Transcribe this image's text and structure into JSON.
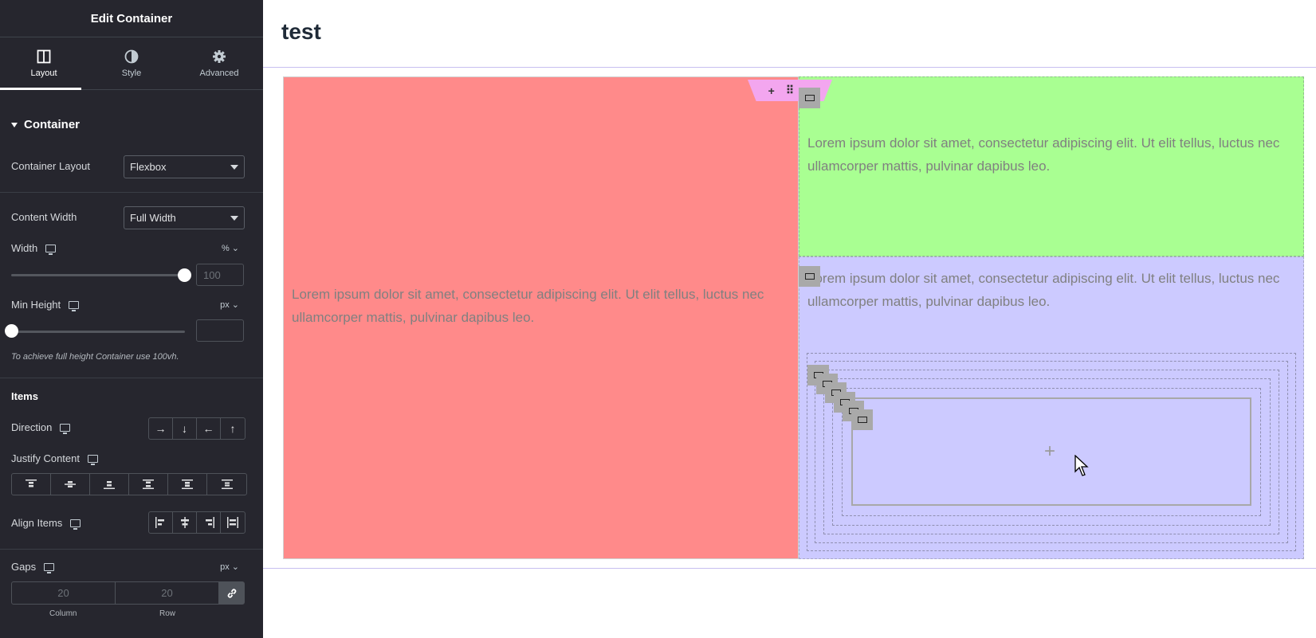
{
  "sidebar": {
    "title": "Edit Container",
    "tabs": [
      {
        "label": "Layout",
        "icon": "layout-icon",
        "active": true
      },
      {
        "label": "Style",
        "icon": "contrast-icon"
      },
      {
        "label": "Advanced",
        "icon": "gear-icon"
      }
    ],
    "section_title": "Container",
    "container_layout": {
      "label": "Container Layout",
      "value": "Flexbox"
    },
    "content_width": {
      "label": "Content Width",
      "value": "Full Width"
    },
    "width": {
      "label": "Width",
      "unit": "%",
      "value": "100",
      "slider_fraction": 1.0
    },
    "min_height": {
      "label": "Min Height",
      "unit": "px",
      "value": "",
      "slider_fraction": 0.0
    },
    "note": "To achieve full height Container use 100vh.",
    "items_title": "Items",
    "direction": {
      "label": "Direction",
      "options": [
        "→",
        "↓",
        "←",
        "↑"
      ]
    },
    "justify_content": {
      "label": "Justify Content"
    },
    "align_items": {
      "label": "Align Items"
    },
    "gaps": {
      "label": "Gaps",
      "unit": "px",
      "column_placeholder": "20",
      "row_placeholder": "20",
      "column_label": "Column",
      "row_label": "Row"
    }
  },
  "canvas": {
    "page_title": "test",
    "lorem": "Lorem ipsum dolor sit amet, consectetur adipiscing elit. Ut elit tellus, luctus nec ullamcorper mattis, pulvinar dapibus leo.",
    "add_symbol": "+",
    "colors": {
      "red": "#ff8a8a",
      "green": "#a9ff92",
      "blue": "#cccaff",
      "handle": "#f3a6ef"
    }
  }
}
